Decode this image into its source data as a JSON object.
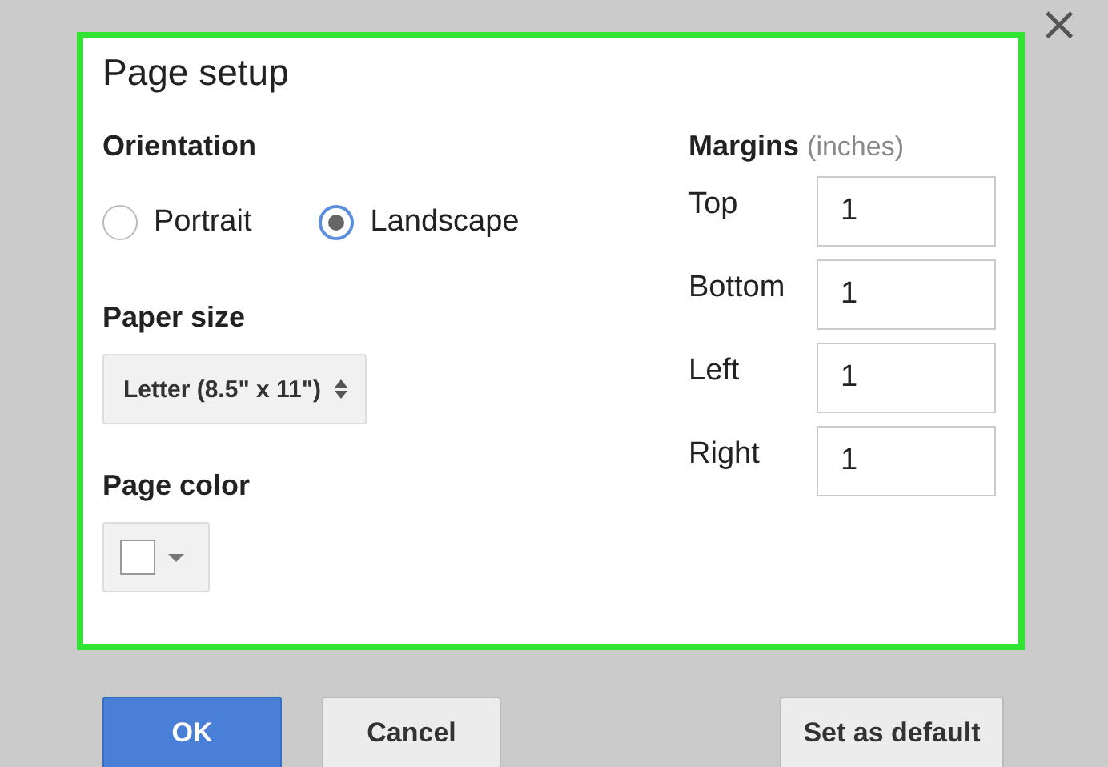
{
  "dialog": {
    "title": "Page setup"
  },
  "orientation": {
    "label": "Orientation",
    "options": [
      {
        "label": "Portrait",
        "selected": false
      },
      {
        "label": "Landscape",
        "selected": true
      }
    ]
  },
  "paper_size": {
    "label": "Paper size",
    "value": "Letter (8.5\" x 11\")"
  },
  "page_color": {
    "label": "Page color",
    "color": "#ffffff"
  },
  "margins": {
    "label": "Margins",
    "unit": "(inches)",
    "fields": [
      {
        "label": "Top",
        "value": "1"
      },
      {
        "label": "Bottom",
        "value": "1"
      },
      {
        "label": "Left",
        "value": "1"
      },
      {
        "label": "Right",
        "value": "1"
      }
    ]
  },
  "close": "×",
  "buttons": [
    {
      "label": "OK",
      "kind": "primary"
    },
    {
      "label": "Cancel",
      "kind": "secondary"
    },
    {
      "label": "Set as default",
      "kind": "secondary"
    }
  ]
}
